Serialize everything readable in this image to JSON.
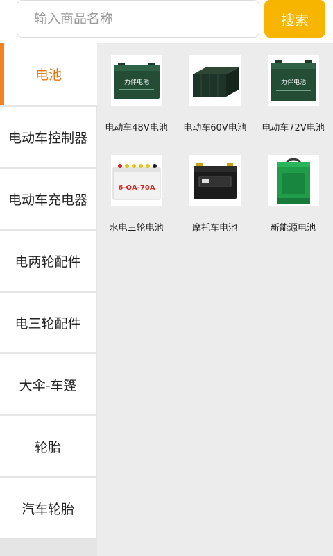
{
  "search": {
    "placeholder": "输入商品名称",
    "button_label": "搜索"
  },
  "colors": {
    "accent": "#f7b500",
    "active_text": "#e8760b",
    "indicator": "#f5821f"
  },
  "sidebar": {
    "active_index": 0,
    "items": [
      {
        "label": "电池"
      },
      {
        "label": "电动车控制器"
      },
      {
        "label": "电动车充电器"
      },
      {
        "label": "电两轮配件"
      },
      {
        "label": "电三轮配件"
      },
      {
        "label": "大伞-车篷"
      },
      {
        "label": "轮胎"
      },
      {
        "label": "汽车轮胎"
      }
    ]
  },
  "products": [
    {
      "name": "电动车48V电池",
      "image": "green-battery-icon",
      "badge": "力伴电池"
    },
    {
      "name": "电动车60V电池",
      "image": "battery-pack-icon"
    },
    {
      "name": "电动车72V电池",
      "image": "green-battery-icon",
      "badge": "力伴电池"
    },
    {
      "name": "水电三轮电池",
      "image": "white-battery-icon",
      "badge": "6-QA-70A"
    },
    {
      "name": "摩托车电池",
      "image": "motorcycle-battery-icon"
    },
    {
      "name": "新能源电池",
      "image": "green-box-battery-icon"
    }
  ]
}
